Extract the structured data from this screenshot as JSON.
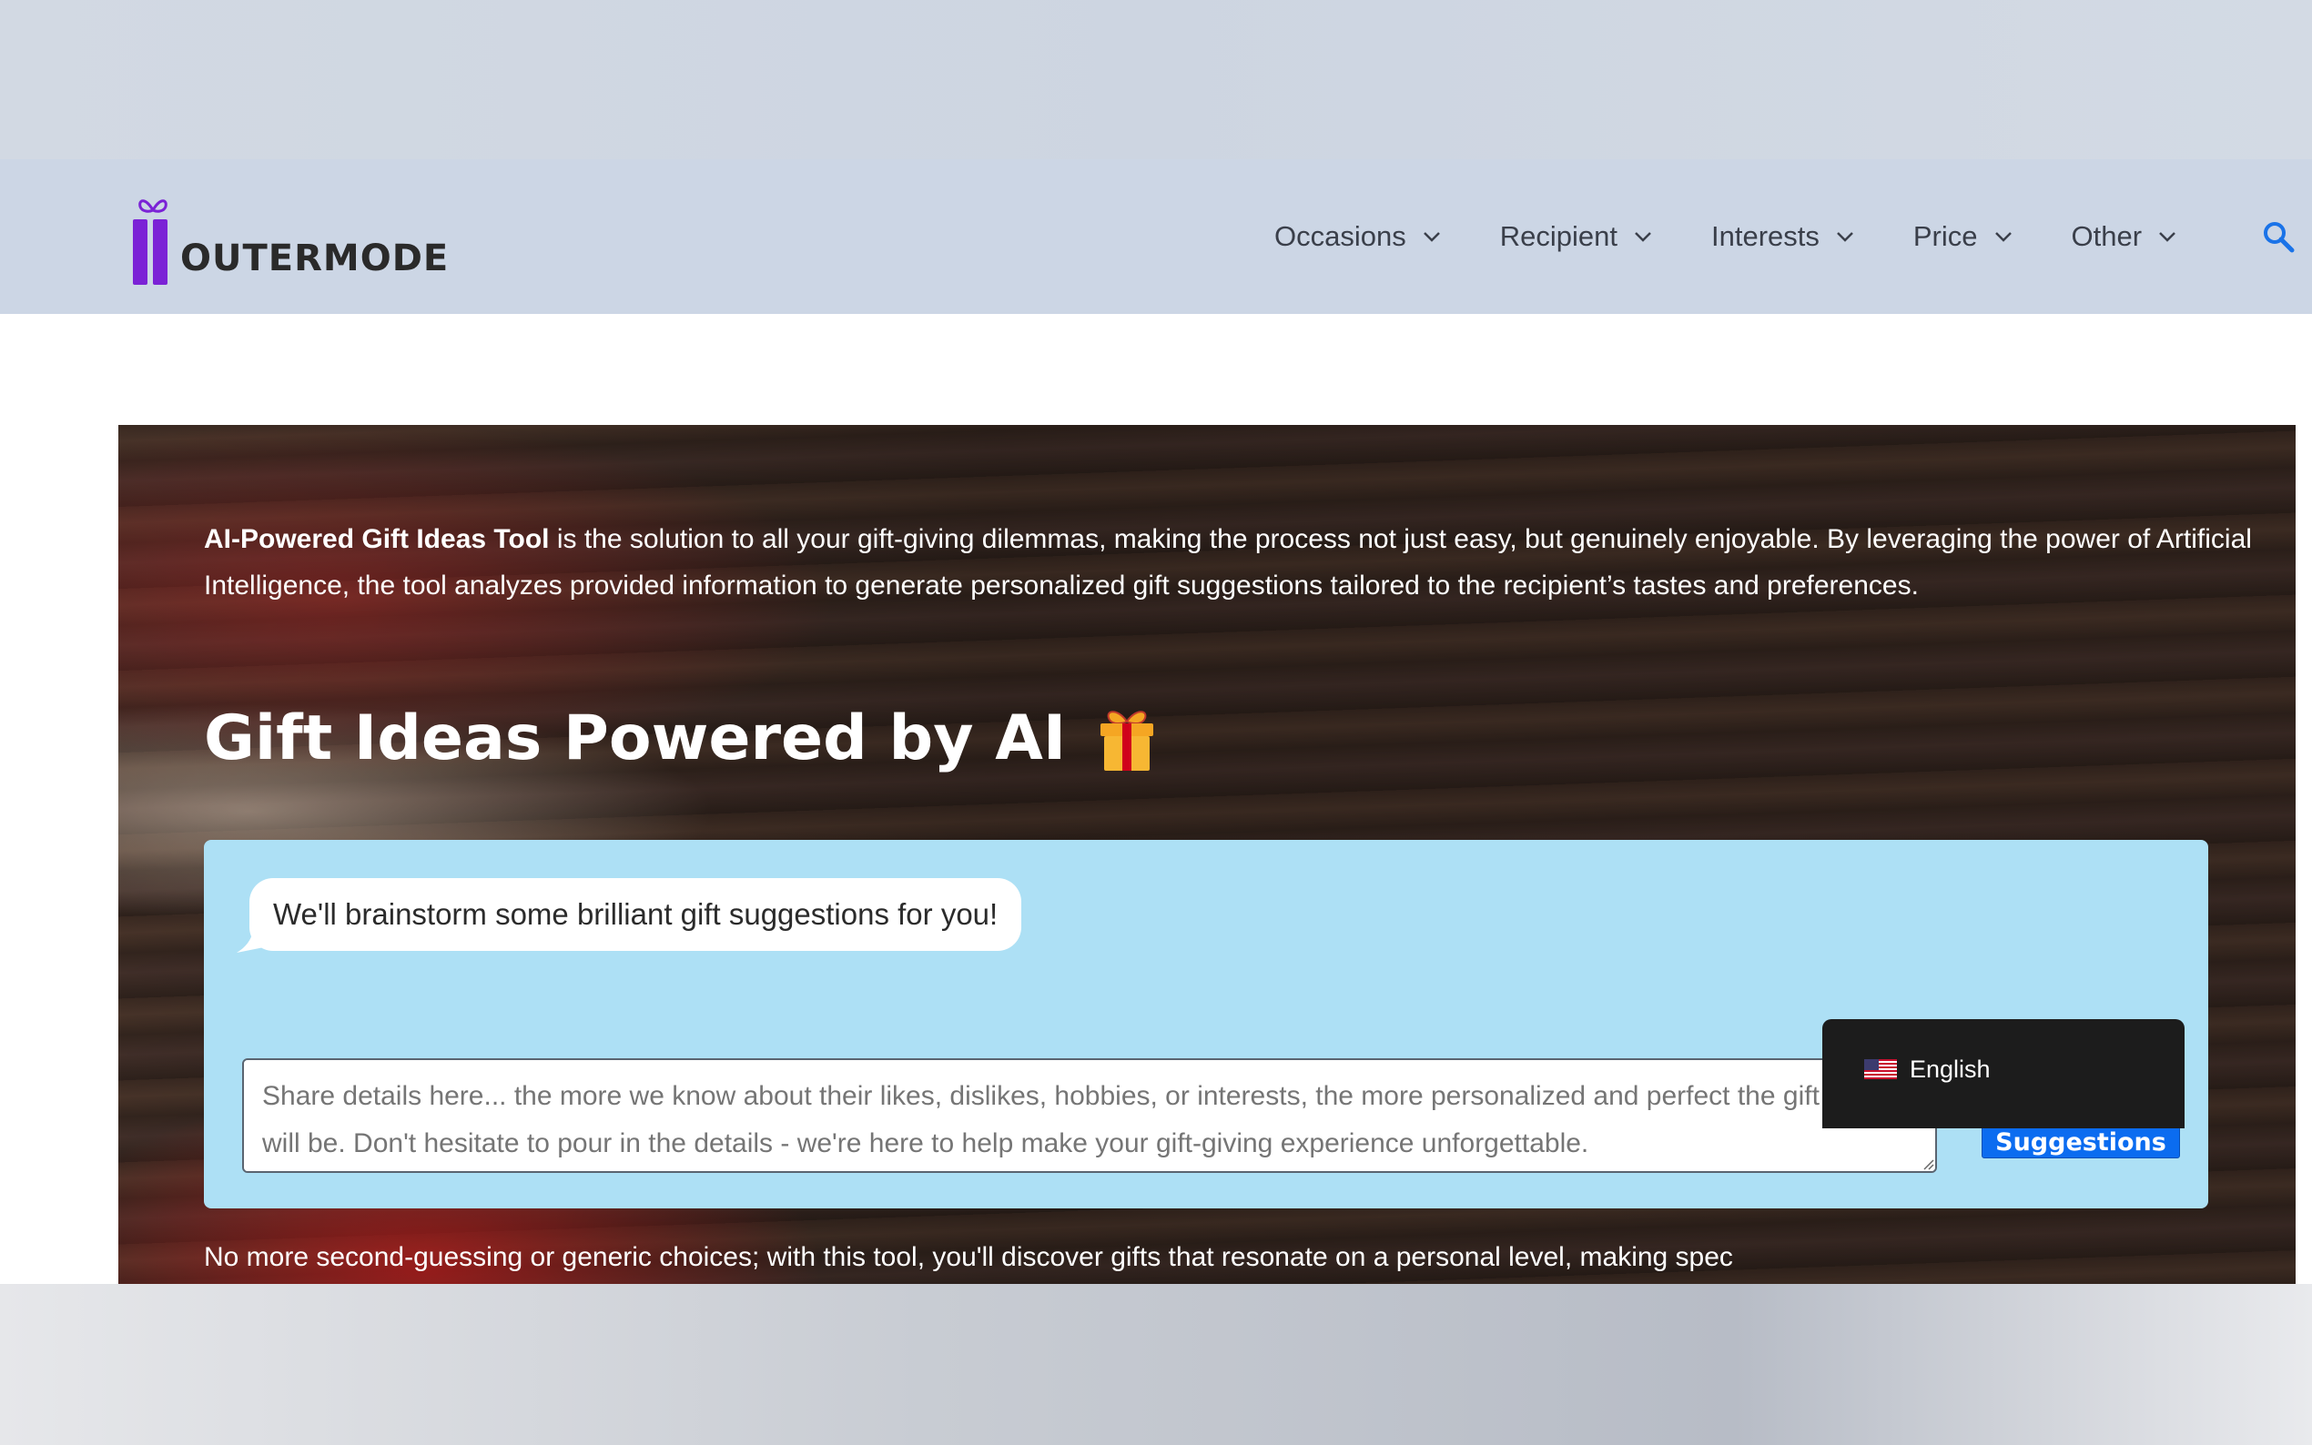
{
  "brand": {
    "name": "OUTERMODE"
  },
  "nav": {
    "items": [
      {
        "label": "Occasions"
      },
      {
        "label": "Recipient"
      },
      {
        "label": "Interests"
      },
      {
        "label": "Price"
      },
      {
        "label": "Other"
      }
    ],
    "search_icon": "search-icon"
  },
  "intro": {
    "bold": "AI-Powered Gift Ideas Tool",
    "rest": " is the solution to all your gift-giving dilemmas, making the process not just easy, but genuinely enjoyable. By leveraging the power of Artificial Intelligence, the tool analyzes provided information to generate personalized gift suggestions tailored to the recipient’s tastes and preferences."
  },
  "tool": {
    "title": "Gift Ideas Powered by AI",
    "title_icon": "gift-icon",
    "bubble": "We'll brainstorm some brilliant gift suggestions for you!",
    "textarea_placeholder": "Share details here... the more we know about their likes, dislikes, hobbies, or interests, the more personalized and perfect the gift idea will be. Don't hesitate to pour in the details - we're here to help make your gift-giving experience unforgettable.",
    "button_label": "Get Gift Suggestions"
  },
  "footer_text": "No more second-guessing or generic choices; with this tool, you'll discover gifts that resonate on a personal level, making spec",
  "language": {
    "label": "English",
    "flag": "us-flag-icon"
  },
  "accessibility": {
    "icon": "accessibility-icon"
  },
  "colors": {
    "header_bg": "#ccd6e5",
    "brand_purple": "#7b22d6",
    "chat_bg": "#ade0f5",
    "button_blue": "#0b6cf0",
    "search_blue": "#1a73e8"
  }
}
